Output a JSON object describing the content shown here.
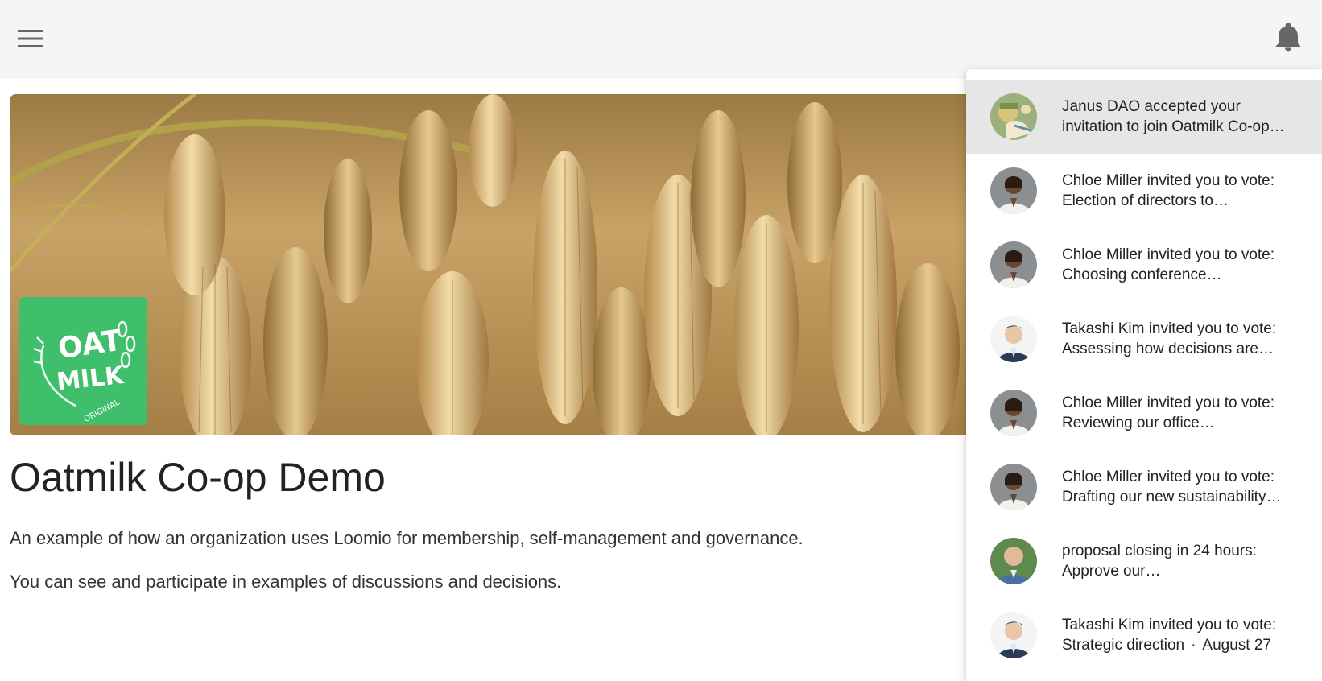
{
  "app_bar": {
    "menu_icon": "menu-icon",
    "bell_icon": "bell-icon"
  },
  "group": {
    "logo_text_line1": "OAT",
    "logo_text_line2": "MILK",
    "logo_text_line3": "ORIGINAL",
    "title": "Oatmilk Co-op Demo",
    "description_1": "An example of how an organization uses Loomio for membership, self-management and governance.",
    "description_2": "You can see and participate in examples of discussions and decisions."
  },
  "notifications": [
    {
      "line1": "Janus DAO accepted your",
      "line2": "invitation to join Oatmilk Co-op…",
      "avatar": "cartoon-avatar",
      "active": true
    },
    {
      "line1": "Chloe Miller invited you to vote:",
      "line2": "Election of directors to…",
      "avatar": "woman-avatar"
    },
    {
      "line1": "Chloe Miller invited you to vote:",
      "line2": "Choosing conference…",
      "avatar": "woman-avatar"
    },
    {
      "line1": "Takashi Kim invited you to vote:",
      "line2": "Assessing how decisions are…",
      "avatar": "man-avatar"
    },
    {
      "line1": "Chloe Miller invited you to vote:",
      "line2": "Reviewing our office…",
      "avatar": "woman-avatar"
    },
    {
      "line1": "Chloe Miller invited you to vote:",
      "line2": "Drafting our new sustainability…",
      "avatar": "woman-avatar"
    },
    {
      "line1": "proposal closing in 24 hours:",
      "line2": "Approve our…",
      "avatar": "bald-man-avatar"
    },
    {
      "line1": "Takashi Kim invited you to vote:",
      "line2": "Strategic direction",
      "separator": "·",
      "date": "August 27",
      "avatar": "man-avatar"
    }
  ],
  "colors": {
    "app_bar_bg": "#f5f5f5",
    "logo_green": "#3fbf6b",
    "active_item_bg": "#e6e6e6"
  }
}
